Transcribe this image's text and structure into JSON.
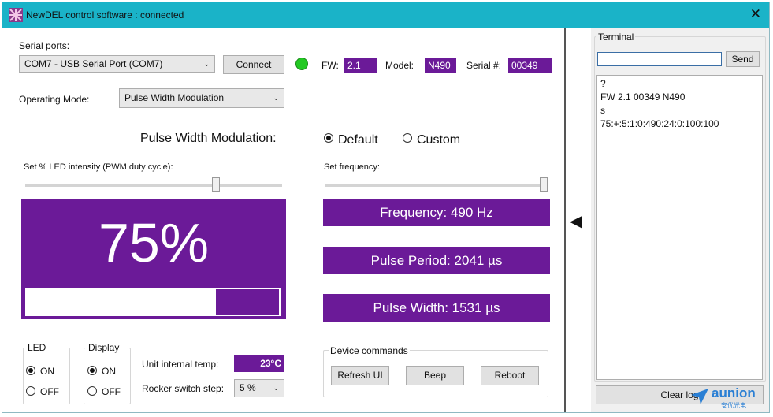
{
  "window": {
    "title": "NewDEL control software : connected",
    "close_glyph": "✕"
  },
  "serial": {
    "label": "Serial ports:",
    "port_value": "COM7 - USB Serial Port (COM7)",
    "connect_label": "Connect",
    "status_color": "#22c922",
    "fw_label": "FW:",
    "fw_value": "2.1",
    "model_label": "Model:",
    "model_value": "N490",
    "serial_label": "Serial #:",
    "serial_value": "00349"
  },
  "mode": {
    "label": "Operating Mode:",
    "value": "Pulse Width Modulation"
  },
  "pwm": {
    "heading": "Pulse Width Modulation:",
    "option_default": "Default",
    "option_custom": "Custom",
    "selected": "Default",
    "intensity_label": "Set % LED intensity (PWM duty cycle):",
    "intensity_percent": 75,
    "intensity_display": "75%",
    "frequency_label": "Set frequency:",
    "frequency_slider_fraction": 1.0,
    "frequency_text": "Frequency: 490 Hz",
    "period_text": "Pulse Period: 2041 µs",
    "width_text": "Pulse Width: 1531 µs"
  },
  "led_group": {
    "title": "LED",
    "on_label": "ON",
    "off_label": "OFF",
    "selected": "ON"
  },
  "display_group": {
    "title": "Display",
    "on_label": "ON",
    "off_label": "OFF",
    "selected": "ON"
  },
  "unit": {
    "temp_label": "Unit internal temp:",
    "temp_value": "23°C",
    "step_label": "Rocker switch step:",
    "step_value": "5 %"
  },
  "device_commands": {
    "title": "Device commands",
    "refresh_label": "Refresh UI",
    "beep_label": "Beep",
    "reboot_label": "Reboot"
  },
  "splitter": {
    "arrow_glyph": "◀"
  },
  "terminal": {
    "title": "Terminal",
    "input_value": "",
    "send_label": "Send",
    "log_lines": [
      "?",
      "FW 2.1 00349 N490",
      "s",
      "75:+:5:1:0:490:24:0:100:100"
    ],
    "clear_label": "Clear log"
  },
  "watermark": {
    "text": "aunion",
    "subtext": "安优光电"
  },
  "colors": {
    "accent": "#6b1a98",
    "titlebar": "#1ab3c8"
  }
}
